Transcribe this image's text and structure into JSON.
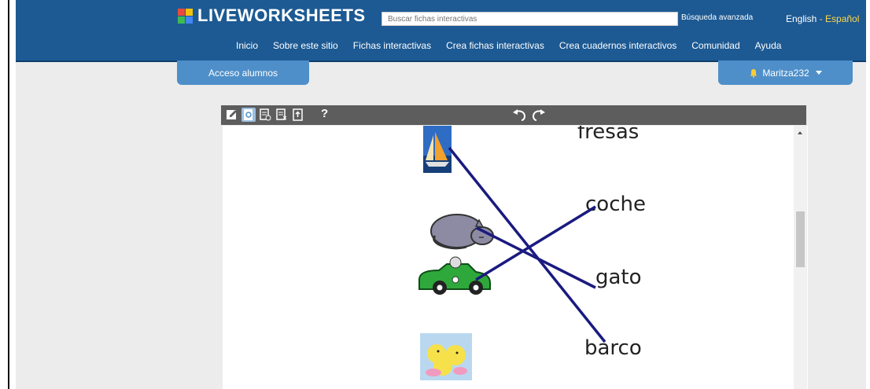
{
  "header": {
    "logo_text": "LIVEWORKSHEETS",
    "search": {
      "placeholder": "Buscar fichas interactivas"
    },
    "advanced_search": "Búsqueda avanzada",
    "lang": {
      "english": "English",
      "separator": " - ",
      "espanol": "Español"
    },
    "nav": [
      "Inicio",
      "Sobre este sitio",
      "Fichas interactivas",
      "Crea fichas interactivas",
      "Crea cuadernos interactivos",
      "Comunidad",
      "Ayuda"
    ]
  },
  "student_access": "Acceso alumnos",
  "user": {
    "name": "Maritza232"
  },
  "toolbar": {
    "tools": [
      "edit-icon",
      "preview-icon",
      "check-icon",
      "clear-icon",
      "export-icon"
    ],
    "help": "?"
  },
  "worksheet": {
    "words": [
      "fresas",
      "coche",
      "gato",
      "barco"
    ],
    "images": [
      "sailboat-image",
      "sleeping-cat-image",
      "green-car-image",
      "chicks-image"
    ],
    "line_color": "#1a1a80"
  },
  "colors": {
    "header_bg": "#1d5a93",
    "tab_bg": "#4e8fc9",
    "lang_accent": "#ffd84a"
  }
}
